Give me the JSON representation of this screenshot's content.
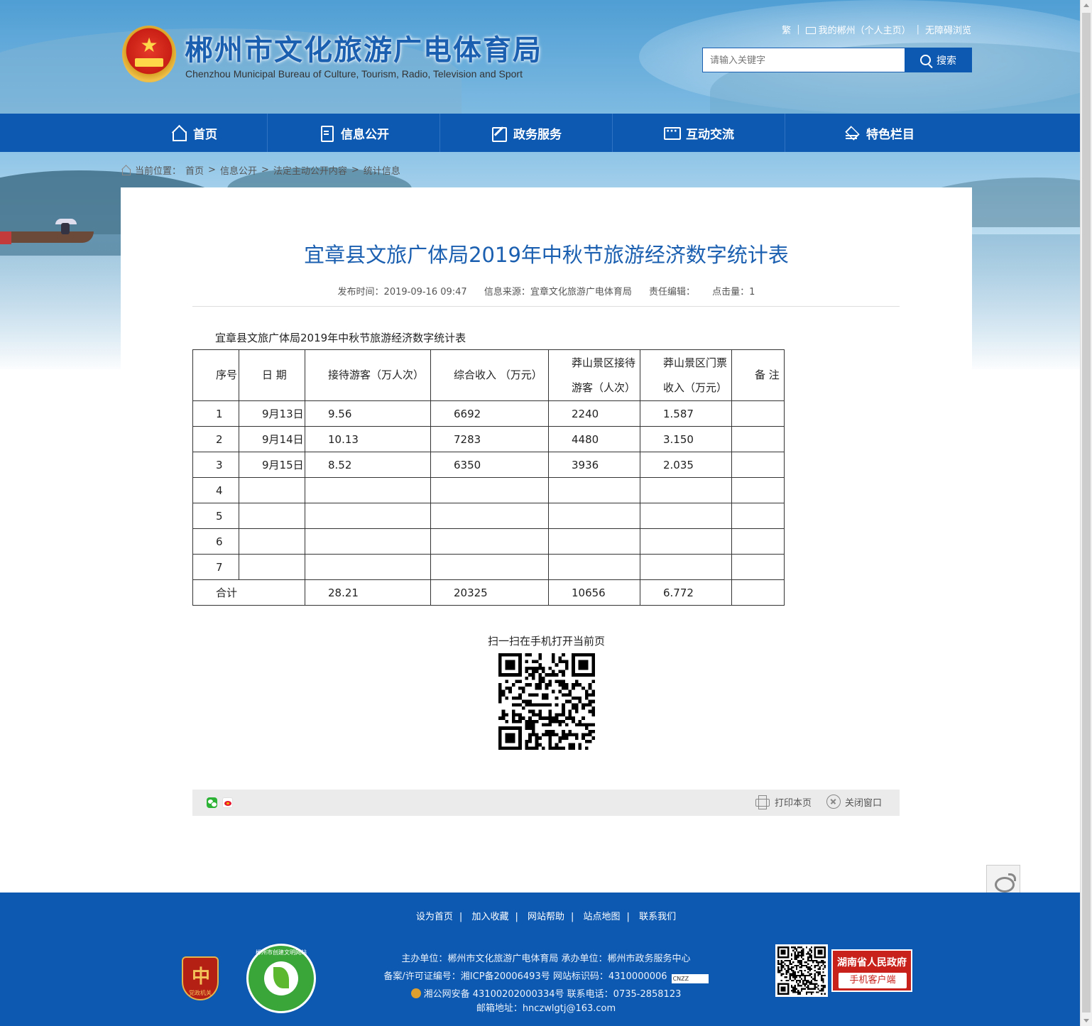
{
  "header": {
    "title": "郴州市文化旅游广电体育局",
    "subtitle": "Chenzhou Municipal Bureau of Culture, Tourism, Radio, Television and Sport",
    "links": {
      "traditional": "繁",
      "my_chenzhou": "我的郴州（个人主页）",
      "accessible": "无障碍浏览"
    },
    "search": {
      "placeholder": "请输入关键字",
      "button": "搜索"
    }
  },
  "nav": [
    {
      "label": "首页",
      "icon": "home-icon"
    },
    {
      "label": "信息公开",
      "icon": "document-icon"
    },
    {
      "label": "政务服务",
      "icon": "edit-icon"
    },
    {
      "label": "互动交流",
      "icon": "chat-icon"
    },
    {
      "label": "特色栏目",
      "icon": "layers-icon"
    }
  ],
  "breadcrumb": {
    "prefix": "当前位置：",
    "items": [
      "首页",
      "信息公开",
      "法定主动公开内容",
      "统计信息"
    ],
    "separator": ">"
  },
  "article": {
    "title": "宜章县文旅广体局2019年中秋节旅游经济数字统计表",
    "publish_time": "发布时间：2019-09-16 09:47",
    "source": "信息来源：宜章文化旅游广电体育局",
    "editor": "责任编辑：",
    "hits": "点击量：1"
  },
  "table": {
    "caption": "宜章县文旅广体局2019年中秋节旅游经济数字统计表",
    "headers": {
      "seq": "序号",
      "date": "日  期",
      "visitors": "接待游客（万人次）",
      "income": "综合收入 （万元）",
      "mangshan_visitors_1": "莽山景区接待",
      "mangshan_visitors_2": "游客（人次）",
      "mangshan_ticket_1": "莽山景区门票",
      "mangshan_ticket_2": "收入（万元）",
      "remark": "备  注"
    },
    "rows": [
      {
        "seq": "1",
        "date": "9月13日",
        "visitors": "9.56",
        "income": "6692",
        "ms_visitors": "2240",
        "ms_ticket": "1.587",
        "remark": ""
      },
      {
        "seq": "2",
        "date": "9月14日",
        "visitors": "10.13",
        "income": "7283",
        "ms_visitors": "4480",
        "ms_ticket": "3.150",
        "remark": ""
      },
      {
        "seq": "3",
        "date": "9月15日",
        "visitors": "8.52",
        "income": "6350",
        "ms_visitors": "3936",
        "ms_ticket": "2.035",
        "remark": ""
      },
      {
        "seq": "4",
        "date": "",
        "visitors": "",
        "income": "",
        "ms_visitors": "",
        "ms_ticket": "",
        "remark": ""
      },
      {
        "seq": "5",
        "date": "",
        "visitors": "",
        "income": "",
        "ms_visitors": "",
        "ms_ticket": "",
        "remark": ""
      },
      {
        "seq": "6",
        "date": "",
        "visitors": "",
        "income": "",
        "ms_visitors": "",
        "ms_ticket": "",
        "remark": ""
      },
      {
        "seq": "7",
        "date": "",
        "visitors": "",
        "income": "",
        "ms_visitors": "",
        "ms_ticket": "",
        "remark": ""
      }
    ],
    "total": {
      "label": "合计",
      "visitors": "28.21",
      "income": "20325",
      "ms_visitors": "10656",
      "ms_ticket": "6.772",
      "remark": ""
    }
  },
  "qr": {
    "label": "扫一扫在手机打开当前页"
  },
  "tools": {
    "print": "打印本页",
    "close": "关闭窗口"
  },
  "footer": {
    "links": [
      "设为首页",
      "加入收藏",
      "网站帮助",
      "站点地图",
      "联系我们"
    ],
    "line1": "主办单位：郴州市文化旅游广电体育局  承办单位：郴州市政务服务中心",
    "line2": "备案/许可证编号：湘ICP备20006493号   网站标识码：4310000006",
    "cnzz": "CNZZ",
    "line3": "湘公网安备 43100202000334号  联系电话：0735-2858123",
    "line4": "邮箱地址：hnczwlgtj@163.com",
    "badge1_caption": "党政机关",
    "badge2_caption": "郴州市创建文明网站",
    "hunan_title": "湖南省人民政府",
    "hunan_app": "手机客户端"
  },
  "colors": {
    "primary": "#0d58b0",
    "title_blue": "#1a5fb0"
  }
}
